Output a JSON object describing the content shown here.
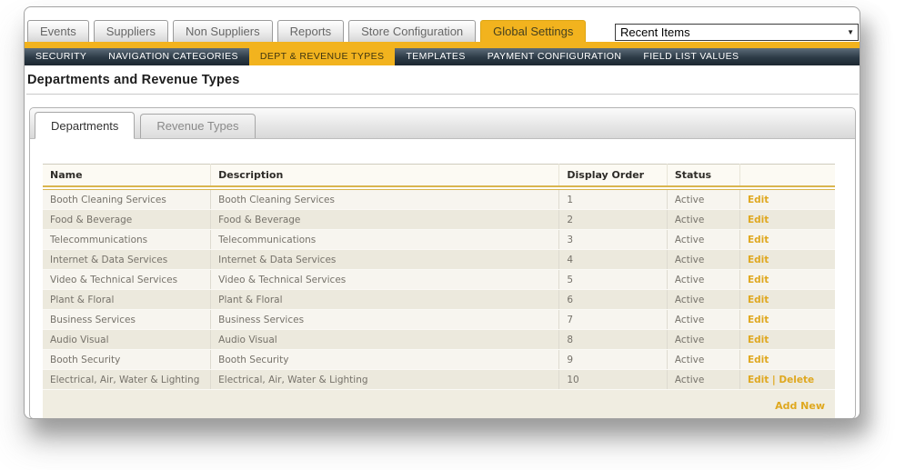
{
  "top_nav": {
    "tabs": [
      {
        "label": "Events",
        "active": false
      },
      {
        "label": "Suppliers",
        "active": false
      },
      {
        "label": "Non Suppliers",
        "active": false
      },
      {
        "label": "Reports",
        "active": false
      },
      {
        "label": "Store Configuration",
        "active": false
      },
      {
        "label": "Global Settings",
        "active": true
      }
    ],
    "recent_items": {
      "value": "Recent Items"
    }
  },
  "sub_nav": {
    "items": [
      {
        "label": "SECURITY",
        "active": false
      },
      {
        "label": "NAVIGATION CATEGORIES",
        "active": false
      },
      {
        "label": "DEPT & REVENUE TYPES",
        "active": true
      },
      {
        "label": "TEMPLATES",
        "active": false
      },
      {
        "label": "PAYMENT CONFIGURATION",
        "active": false
      },
      {
        "label": "FIELD LIST VALUES",
        "active": false
      }
    ]
  },
  "page": {
    "title": "Departments and Revenue Types"
  },
  "panel": {
    "tabs": [
      {
        "label": "Departments",
        "active": true
      },
      {
        "label": "Revenue Types",
        "active": false
      }
    ]
  },
  "table": {
    "columns": [
      "Name",
      "Description",
      "Display Order",
      "Status",
      ""
    ],
    "rows": [
      {
        "name": "Booth Cleaning Services",
        "description": "Booth Cleaning Services",
        "display_order": "1",
        "status": "Active",
        "actions": [
          "Edit"
        ]
      },
      {
        "name": "Food & Beverage",
        "description": "Food & Beverage",
        "display_order": "2",
        "status": "Active",
        "actions": [
          "Edit"
        ]
      },
      {
        "name": "Telecommunications",
        "description": "Telecommunications",
        "display_order": "3",
        "status": "Active",
        "actions": [
          "Edit"
        ]
      },
      {
        "name": "Internet & Data Services",
        "description": "Internet & Data Services",
        "display_order": "4",
        "status": "Active",
        "actions": [
          "Edit"
        ]
      },
      {
        "name": "Video & Technical Services",
        "description": "Video & Technical Services",
        "display_order": "5",
        "status": "Active",
        "actions": [
          "Edit"
        ]
      },
      {
        "name": "Plant & Floral",
        "description": "Plant & Floral",
        "display_order": "6",
        "status": "Active",
        "actions": [
          "Edit"
        ]
      },
      {
        "name": "Business Services",
        "description": "Business Services",
        "display_order": "7",
        "status": "Active",
        "actions": [
          "Edit"
        ]
      },
      {
        "name": "Audio Visual",
        "description": "Audio Visual",
        "display_order": "8",
        "status": "Active",
        "actions": [
          "Edit"
        ]
      },
      {
        "name": "Booth Security",
        "description": "Booth Security",
        "display_order": "9",
        "status": "Active",
        "actions": [
          "Edit"
        ]
      },
      {
        "name": "Electrical, Air, Water & Lighting",
        "description": "Electrical, Air, Water & Lighting",
        "display_order": "10",
        "status": "Active",
        "actions": [
          "Edit",
          "Delete"
        ]
      }
    ],
    "action_separator": " | ",
    "add_new_label": "Add New"
  },
  "colors": {
    "accent_gold": "#F2B31E",
    "link_gold": "#DFA81F",
    "dark_nav": "#2C3A46",
    "row_light": "#F7F5EF",
    "row_cream": "#ECE9DD",
    "header_rule_gold": "#D9B54E"
  }
}
